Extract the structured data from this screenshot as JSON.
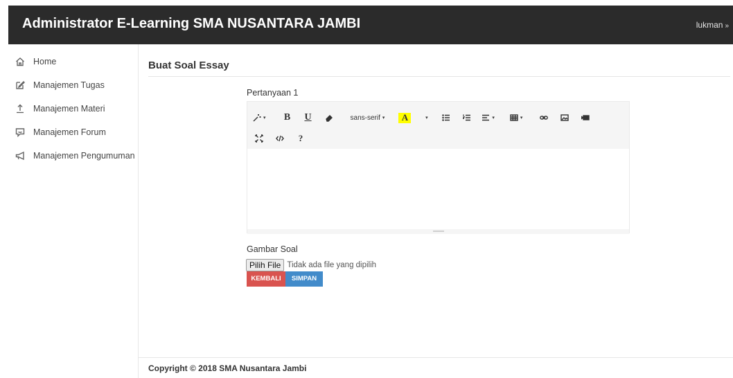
{
  "header": {
    "brand": "Administrator E-Learning SMA NUSANTARA JAMBI",
    "user": "lukman",
    "user_chevron": "»",
    "bg_color": "#2b2b2b"
  },
  "sidebar": {
    "items": [
      {
        "label": "Home",
        "icon": "home-icon"
      },
      {
        "label": "Manajemen Tugas",
        "icon": "edit-icon"
      },
      {
        "label": "Manajemen Materi",
        "icon": "upload-icon"
      },
      {
        "label": "Manajemen Forum",
        "icon": "chat-icon"
      },
      {
        "label": "Manajemen Pengumuman",
        "icon": "megaphone-icon"
      }
    ]
  },
  "main": {
    "title": "Buat Soal Essay",
    "question_label": "Pertanyaan 1",
    "toolbar": {
      "font_family": "sans-serif",
      "bold": "B",
      "underline": "U",
      "highlight": "A",
      "help": "?"
    },
    "image_label": "Gambar Soal",
    "file_button": "Pilih File",
    "file_status": "Tidak ada file yang dipilih",
    "back_button": "KEMBALI",
    "save_button": "SIMPAN"
  },
  "footer": {
    "text": "Copyright © 2018 SMA Nusantara Jambi"
  },
  "colors": {
    "danger": "#d9534f",
    "primary": "#428bca"
  }
}
